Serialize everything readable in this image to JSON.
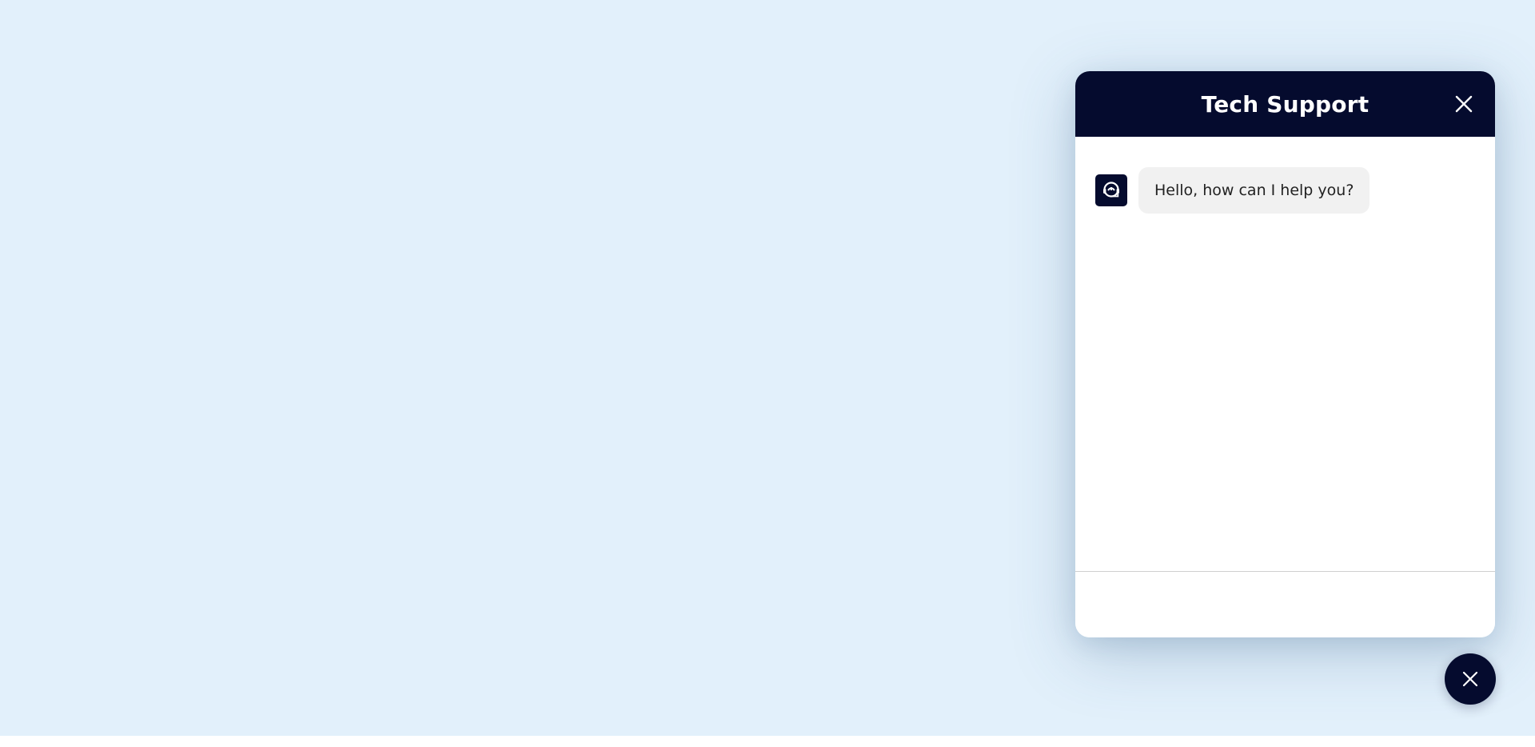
{
  "chat": {
    "title": "Tech Support",
    "close_icon": "close-icon",
    "avatar_icon": "headset-support-icon",
    "messages": [
      {
        "sender": "agent",
        "text": "Hello, how can I help you?"
      }
    ],
    "input": {
      "value": "",
      "placeholder": ""
    }
  },
  "launcher": {
    "icon": "close-icon",
    "state": "open"
  },
  "colors": {
    "page_background": "#e2f0fb",
    "header_background": "#050b2e",
    "bubble_background": "#f1f1f1",
    "header_text": "#ffffff"
  }
}
